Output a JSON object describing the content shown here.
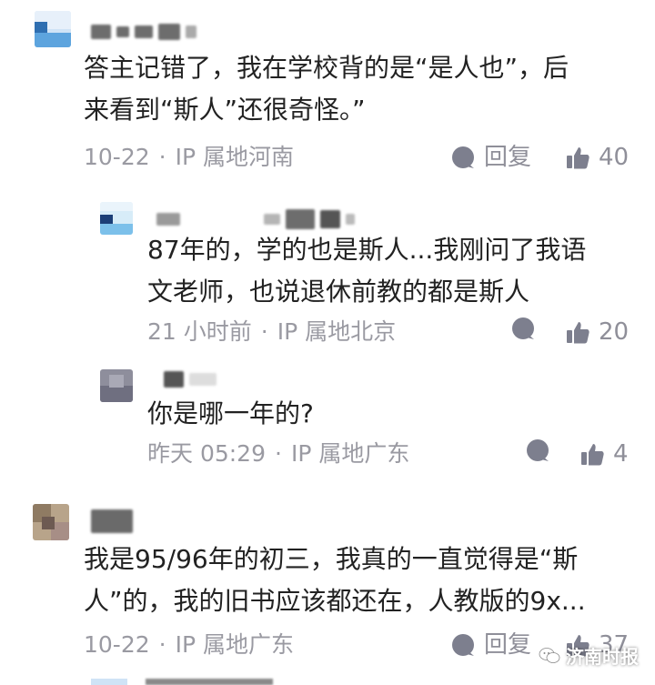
{
  "comments": [
    {
      "text_lines": [
        "答主记错了，我在学校背的是“是人也”，后",
        "来看到“斯人”还很奇怪。”"
      ],
      "date": "10-22",
      "separator": "·",
      "location": "IP 属地河南",
      "reply_label": "回复",
      "likes": "40"
    },
    {
      "text_lines": [
        "87年的，学的也是斯人...我刚问了我语",
        "文老师，也说退休前教的都是斯人"
      ],
      "date": "21 小时前",
      "separator": "·",
      "location": "IP 属地北京",
      "likes": "20"
    },
    {
      "text_lines": [
        "你是哪一年的?"
      ],
      "date": "昨天 05:29",
      "separator": "·",
      "location": "IP 属地广东",
      "likes": "4"
    },
    {
      "text_lines": [
        "我是95/96年的初三，我真的一直觉得是“斯",
        "人”的，我的旧书应该都还在，人教版的9x..."
      ],
      "date": "10-22",
      "separator": "·",
      "location": "IP 属地广东",
      "reply_label": "回复",
      "likes": "37"
    }
  ],
  "watermark": {
    "text": "济南时报"
  },
  "icons": {
    "comment": "comment-bubble-icon",
    "like": "thumbs-up-icon"
  },
  "colors": {
    "meta": "#9a9aa2",
    "icon": "#7d7f8e"
  }
}
